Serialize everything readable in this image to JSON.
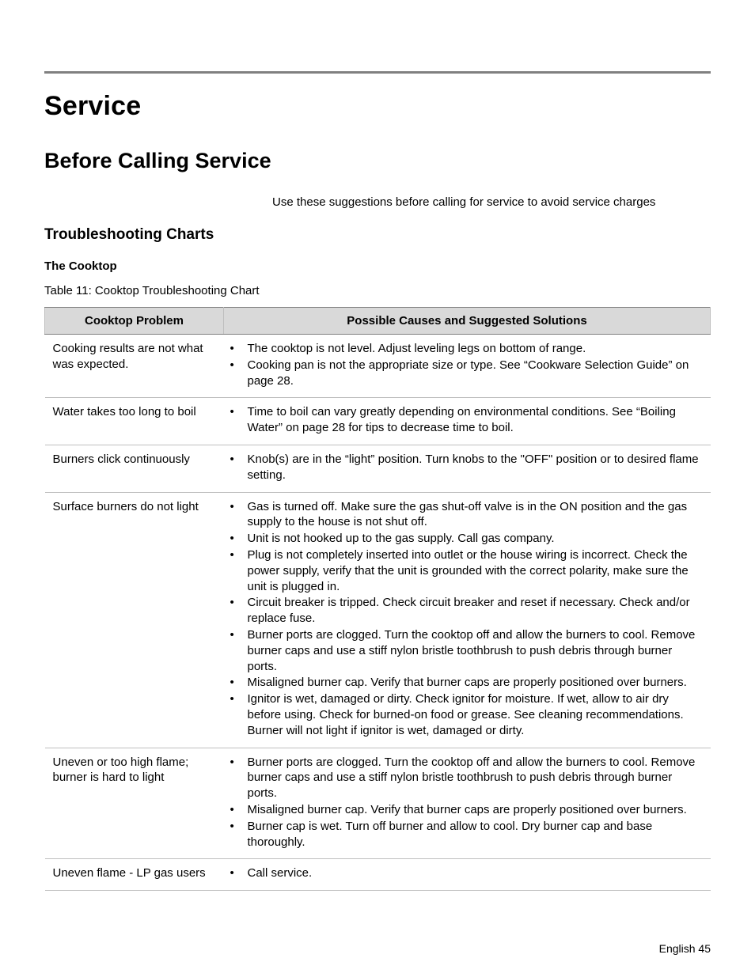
{
  "heading1": "Service",
  "heading2": "Before Calling Service",
  "intro": "Use these suggestions before calling for service to avoid service charges",
  "heading3": "Troubleshooting Charts",
  "heading4": "The Cooktop",
  "table_caption": "Table 11: Cooktop Troubleshooting Chart",
  "table": {
    "col1_header": "Cooktop Problem",
    "col2_header": "Possible Causes and Suggested Solutions",
    "rows": [
      {
        "problem": "Cooking results are not what was expected.",
        "solutions": [
          "The cooktop is not level. Adjust leveling legs on bottom of range.",
          "Cooking pan is not the appropriate size or type. See “Cookware Selection Guide” on page 28."
        ]
      },
      {
        "problem": "Water takes too long to boil",
        "solutions": [
          "Time to boil can vary greatly depending on environmental conditions. See “Boiling Water” on page 28 for tips to decrease time to boil."
        ]
      },
      {
        "problem": "Burners click continuously",
        "solutions": [
          "Knob(s) are in the “light” position. Turn knobs to the \"OFF\" position or to desired flame setting."
        ]
      },
      {
        "problem": "Surface burners do not light",
        "solutions": [
          "Gas is turned off. Make sure the gas shut-off valve is in the ON position and the gas supply to the house is not shut off.",
          "Unit is not hooked up to the gas supply. Call gas company.",
          "Plug is not completely inserted into outlet or the house wiring is incorrect. Check the power supply, verify that the unit is grounded with the correct polarity, make sure the unit is plugged in.",
          "Circuit breaker is tripped. Check circuit breaker and reset if necessary. Check and/or replace fuse.",
          "Burner ports are clogged. Turn the cooktop off and allow the burners to cool. Remove burner caps and use a stiff nylon bristle toothbrush to push debris through burner ports.",
          "Misaligned burner cap. Verify that burner caps are properly positioned over burners.",
          "Ignitor is wet, damaged or dirty. Check ignitor for moisture. If wet, allow to air dry before using. Check for burned-on food or grease. See cleaning recommendations. Burner will not light if ignitor is wet, damaged or dirty."
        ]
      },
      {
        "problem": "Uneven or too high flame; burner is hard to light",
        "solutions": [
          "Burner ports are clogged. Turn the cooktop off and allow the burners to cool. Remove burner caps and use a stiff nylon bristle toothbrush to push debris through burner ports.",
          "Misaligned burner cap. Verify that burner caps are properly positioned over burners.",
          "Burner cap is wet. Turn off burner and allow to cool. Dry burner cap and base thoroughly."
        ]
      },
      {
        "problem": "Uneven flame - LP gas users",
        "solutions": [
          "Call service."
        ]
      }
    ]
  },
  "footer": "English 45"
}
